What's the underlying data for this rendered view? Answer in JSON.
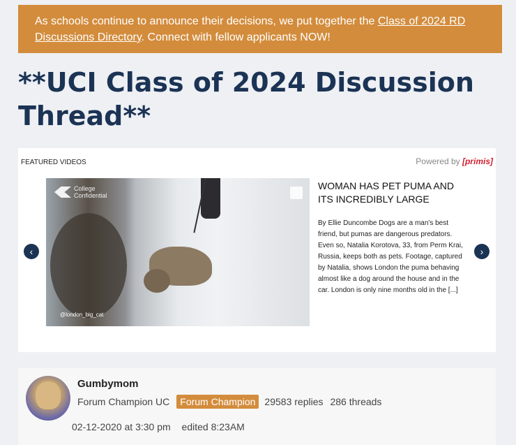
{
  "banner": {
    "text_before": "As schools continue to announce their decisions, we put together the ",
    "link": "Class of 2024 RD Discussions Directory",
    "text_after": ". Connect with fellow applicants NOW!"
  },
  "page_title": "**UCI Class of 2024 Discussion Thread**",
  "video": {
    "featured_label": "FEATURED VIDEOS",
    "powered_by": "Powered by",
    "powered_brand": "[primis]",
    "logo_text_line1": "College",
    "logo_text_line2": "Confidential",
    "watermark": "@london_big_cat",
    "title": "WOMAN HAS PET PUMA AND ITS INCREDIBLY LARGE",
    "description": "By Ellie Duncombe Dogs are a man's best friend, but pumas are dangerous predators. Even so, Natalia Korotova, 33, from Perm Krai, Russia, keeps both as pets. Footage, captured by Natalia, shows London the puma behaving almost like a dog around the house and in the car. London is only nine months old in the [...]",
    "prev_icon": "chevron-left-icon",
    "next_icon": "chevron-right-icon"
  },
  "post": {
    "username": "Gumbymom",
    "role": "Forum Champion UC",
    "badge": "Forum Champion",
    "replies": "29583 replies",
    "threads": "286 threads",
    "timestamp": "02-12-2020 at 3:30 pm",
    "edited": "edited 8:23AM"
  },
  "colors": {
    "accent": "#d38c3c",
    "title": "#1b3354",
    "background": "#eef0f4"
  }
}
